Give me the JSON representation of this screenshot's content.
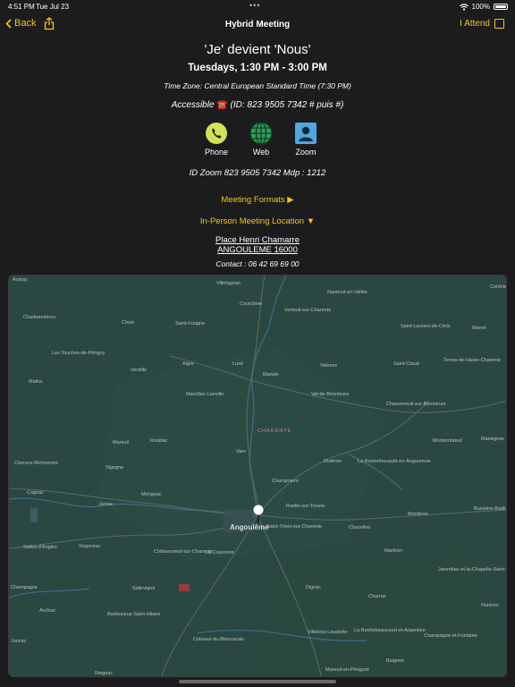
{
  "status_bar": {
    "time": "4:51 PM",
    "date": "Tue Jul 23",
    "battery": "100%"
  },
  "nav": {
    "back_label": "Back",
    "title": "Hybrid Meeting",
    "attend_label": "I Attend"
  },
  "meeting": {
    "name": "'Je' devient 'Nous'",
    "time": "Tuesdays, 1:30 PM - 3:00 PM",
    "time_zone": "Time Zone: Central European Standard Time (7:30 PM)",
    "accessible_prefix": "Accessible ",
    "accessible_icon": "☎️",
    "accessible_suffix": " (ID: 823 9505 7342 # puis #)",
    "zoom_id": "ID Zoom 823 9505 7342 Mdp : 1212"
  },
  "methods": [
    {
      "label": "Phone",
      "icon": "phone-icon",
      "color": "#d4e157"
    },
    {
      "label": "Web",
      "icon": "globe-icon",
      "color": "#2e9e57"
    },
    {
      "label": "Zoom",
      "icon": "person-icon",
      "color": "#4ea8de"
    }
  ],
  "links": {
    "formats": "Meeting Formats ▶",
    "location": "In-Person Meeting Location ▼"
  },
  "address": {
    "line1": "Place Henri Chamarre",
    "line2": "ANGOULEME 16000",
    "contact": "Contact : 06 42 69 69 00"
  },
  "map": {
    "center_label": "Angoulême",
    "places": [
      "Aulnay",
      "Villefagnan",
      "Nanteuil-en-Vallée",
      "Confolens",
      "Courcôme",
      "Verteuil-sur-Charente",
      "Charbonnières",
      "Chizé",
      "Saint-Fraigne",
      "Saint-Laurent-de-Céris",
      "Manot",
      "Les Touches-de-Périgny",
      "Verdille",
      "Aigre",
      "Luxé",
      "Mansle",
      "Valence",
      "Saint-Claud",
      "Terres-de-Haute-Charente",
      "Matha",
      "Marcillac-Lanville",
      "Val-de-Bonnieure",
      "Chasseneuil-sur-Bonnieure",
      "CHARENTE",
      "Mareuil",
      "Rouillac",
      "Montembœuf",
      "Massignac",
      "Cherves-Richemont",
      "Sigogne",
      "Vars",
      "Rivières",
      "La Rochefoucauld-en-Angoumois",
      "Champniers",
      "Cognac",
      "Jarnac",
      "Mérignac",
      "Ruelle-sur-Touvre",
      "Montbron",
      "Bussière-Badil",
      "Saint-Yrieix-sur-Charente",
      "Chazelles",
      "Salles-d'Angles",
      "Segonzac",
      "Châteauneuf-sur-Charente",
      "La Couronne",
      "Marthon",
      "Javerlhac-et-la-Chapelle-Saint-Robert",
      "Champagne",
      "Sallevigne",
      "Dignac",
      "Charras",
      "Nontron",
      "Archiac",
      "Barbezieux-Saint-Hilaire",
      "Coteaux-du-Blanzacais",
      "Villebois-Lavalette",
      "La Rochebeaucourt-et-Argentine",
      "Jonzac",
      "Baignes",
      "Mareuil-en-Périgord",
      "Champagne-et-Fontaine",
      "Reignac"
    ]
  }
}
